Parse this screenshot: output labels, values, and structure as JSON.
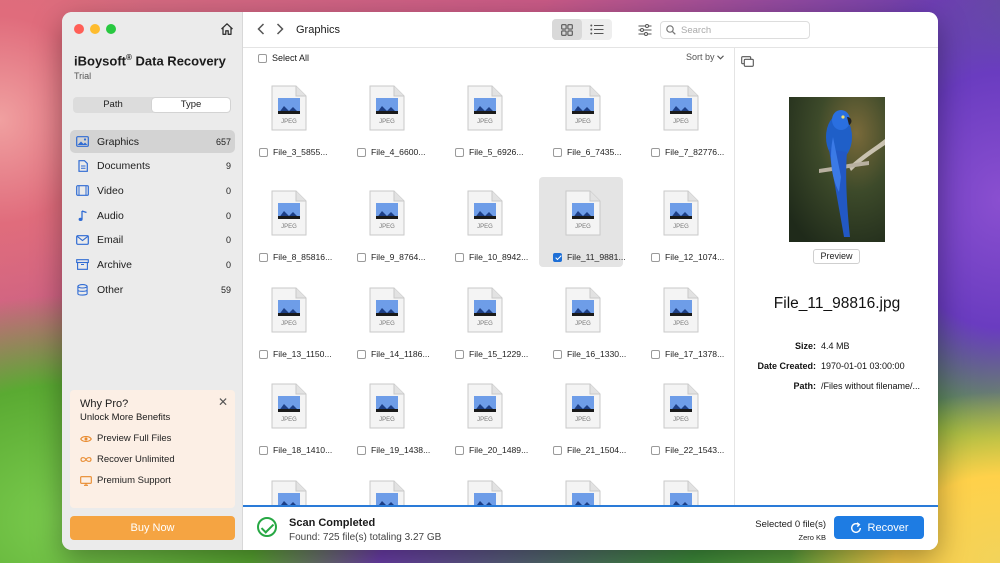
{
  "sidebar": {
    "brand": "iBoysoft",
    "brand_sup": "®",
    "brand_suffix": " Data Recovery",
    "subtitle": "Trial",
    "segments": [
      "Path",
      "Type"
    ],
    "active_segment": "Type",
    "categories": [
      {
        "label": "Graphics",
        "count": "657",
        "icon": "image-icon",
        "selected": true
      },
      {
        "label": "Documents",
        "count": "9",
        "icon": "document-icon"
      },
      {
        "label": "Video",
        "count": "0",
        "icon": "video-icon"
      },
      {
        "label": "Audio",
        "count": "0",
        "icon": "music-note-icon"
      },
      {
        "label": "Email",
        "count": "0",
        "icon": "envelope-icon"
      },
      {
        "label": "Archive",
        "count": "0",
        "icon": "archive-box-icon"
      },
      {
        "label": "Other",
        "count": "59",
        "icon": "database-icon"
      }
    ],
    "promo": {
      "title": "Why Pro?",
      "subtitle": "Unlock More Benefits",
      "items": [
        {
          "label": "Preview Full Files",
          "icon": "eye-icon"
        },
        {
          "label": "Recover Unlimited",
          "icon": "infinity-icon"
        },
        {
          "label": "Premium Support",
          "icon": "monitor-icon"
        }
      ]
    },
    "buy_label": "Buy Now"
  },
  "toolbar": {
    "title": "Graphics",
    "search_placeholder": "Search"
  },
  "list": {
    "select_all": "Select All",
    "sort_by": "Sort by",
    "file_type_label": "JPEG",
    "files": [
      {
        "name": "File_3_5855..."
      },
      {
        "name": "File_4_6600..."
      },
      {
        "name": "File_5_6926..."
      },
      {
        "name": "File_6_7435..."
      },
      {
        "name": "File_7_82776..."
      },
      {
        "name": "File_8_85816..."
      },
      {
        "name": "File_9_8764..."
      },
      {
        "name": "File_10_8942..."
      },
      {
        "name": "File_11_9881...",
        "checked": true
      },
      {
        "name": "File_12_1074..."
      },
      {
        "name": "File_13_1150..."
      },
      {
        "name": "File_14_1186..."
      },
      {
        "name": "File_15_1229..."
      },
      {
        "name": "File_16_1330..."
      },
      {
        "name": "File_17_1378..."
      },
      {
        "name": "File_18_1410..."
      },
      {
        "name": "File_19_1438..."
      },
      {
        "name": "File_20_1489..."
      },
      {
        "name": "File_21_1504..."
      },
      {
        "name": "File_22_1543..."
      },
      {
        "name": ""
      },
      {
        "name": ""
      },
      {
        "name": ""
      },
      {
        "name": ""
      },
      {
        "name": ""
      }
    ]
  },
  "preview": {
    "button": "Preview",
    "file_name": "File_11_98816.jpg",
    "details": [
      {
        "key": "Size:",
        "value": "4.4 MB"
      },
      {
        "key": "Date Created:",
        "value": "1970-01-01 03:00:00"
      },
      {
        "key": "Path:",
        "value": "/Files without filename/..."
      }
    ]
  },
  "status": {
    "title": "Scan Completed",
    "subtitle": "Found: 725 file(s) totaling 3.27 GB",
    "selected": "Selected 0 file(s)",
    "selected_size": "Zero KB",
    "recover_label": "Recover"
  },
  "colors": {
    "accent": "#1e7ce3",
    "buy": "#f5a442",
    "success": "#27a844",
    "promo_icon": "#e8892c"
  }
}
